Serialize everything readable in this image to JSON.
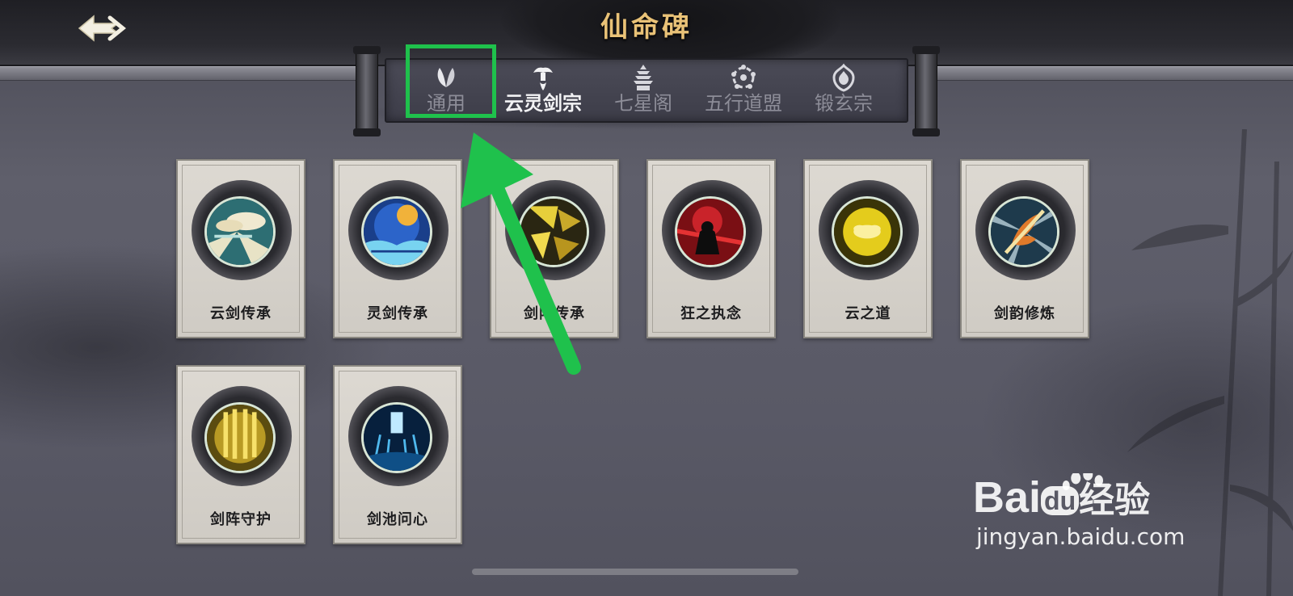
{
  "header": {
    "title": "仙命碑",
    "back_icon": "back-arrow-icon"
  },
  "tabs": [
    {
      "label": "通用",
      "icon": "leaf-icon",
      "active": false
    },
    {
      "label": "云灵剑宗",
      "icon": "cloud-tower-icon",
      "active": true
    },
    {
      "label": "七星阁",
      "icon": "pagoda-icon",
      "active": false
    },
    {
      "label": "五行道盟",
      "icon": "five-elements-icon",
      "active": false
    },
    {
      "label": "锻玄宗",
      "icon": "flame-shield-icon",
      "active": false
    }
  ],
  "cards": [
    {
      "label": "云剑传承",
      "icon": "cloud-sword-icon"
    },
    {
      "label": "灵剑传承",
      "icon": "spirit-sword-icon"
    },
    {
      "label": "剑阵传承",
      "icon": "sword-formation-icon"
    },
    {
      "label": "狂之执念",
      "icon": "red-figure-icon"
    },
    {
      "label": "云之道",
      "icon": "golden-cloud-icon"
    },
    {
      "label": "剑韵修炼",
      "icon": "flaming-sword-icon"
    },
    {
      "label": "剑阵守护",
      "icon": "golden-swords-icon"
    },
    {
      "label": "剑池问心",
      "icon": "sword-pool-icon"
    }
  ],
  "colors": {
    "highlight": "#1fc14c",
    "title_gold": "#e9c277"
  },
  "watermark": {
    "brand": "Bai",
    "brand2": "du",
    "suffix": "经验",
    "url": "jingyan.baidu.com"
  }
}
